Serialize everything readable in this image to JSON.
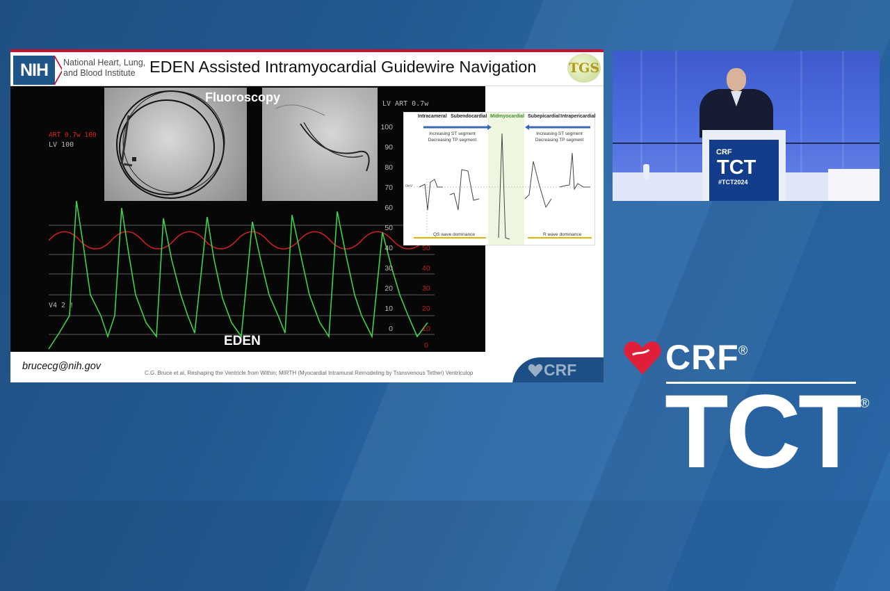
{
  "slide": {
    "org_abbrev": "NIH",
    "org_name": "National Heart, Lung, and Blood Institute",
    "title": "EDEN Assisted Intramyocardial Guidewire Navigation",
    "partner_logo_text": "TGS",
    "video": {
      "top_label": "Fluoroscopy",
      "bottom_label": "EDEN",
      "monitor_text": {
        "art_left": "ART  0.7w  100",
        "lv_left": "LV  100",
        "lv_right": "LV  ART  0.7w",
        "lead": "V4  2  !"
      },
      "scale_left": [
        "100",
        "90",
        "80",
        "70",
        "60",
        "50",
        "40",
        "30",
        "20",
        "10",
        "0"
      ],
      "scale_right": [
        "50",
        "40",
        "30",
        "20",
        "10",
        "0"
      ]
    },
    "inset": {
      "zones": [
        "Intracameral",
        "Subendocardial",
        "Midmyocardial",
        "Subepicardial",
        "Intrapericardial"
      ],
      "left_note": "Increasing ST segment\nDecreasing TP segment",
      "right_note": "Increasing ST segment\nDecreasing TP segment",
      "baseline_label": "0mV",
      "left_foot": "QS wave dominance",
      "right_foot": "R wave dominance"
    },
    "email": "brucecg@nih.gov",
    "citation": "C.G. Bruce et al, Reshaping the Ventricle from Within; MIRTH (Myocardial Intramural Remodeling by Transvenous Tether) Ventriculop",
    "corner_logo_text": "CRF"
  },
  "podium": {
    "brand_small": "CRF",
    "brand_large": "TCT",
    "hashtag": "#TCT2024"
  },
  "brand": {
    "crf": "CRF",
    "tct": "TCT",
    "registered": "®"
  },
  "colors": {
    "background": "#235a93",
    "slide_accent": "#c8102e",
    "nih_blue": "#20558a",
    "ecg_green": "#3fd24a",
    "pressure_red": "#d42020",
    "heart_red": "#e01e37"
  }
}
